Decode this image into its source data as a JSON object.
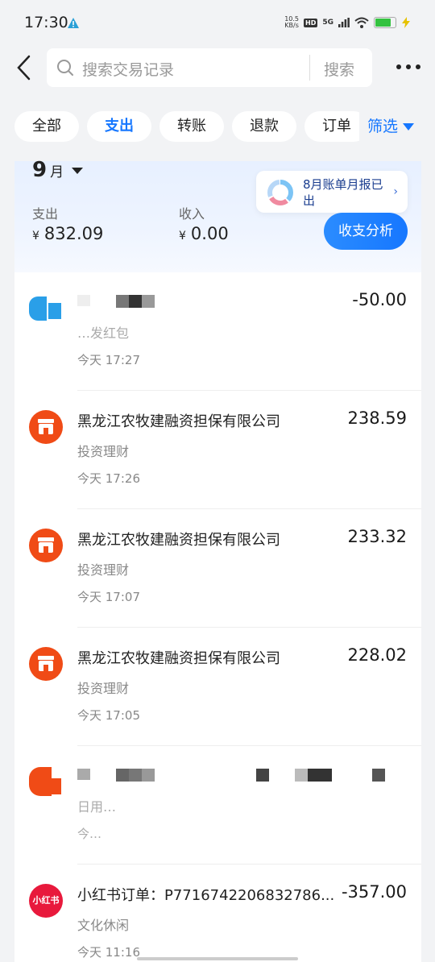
{
  "status_bar": {
    "time": "17:30",
    "net_speed_value": "10.5",
    "net_speed_unit": "KB/s",
    "hd_label": "HD",
    "signal_label": "5G"
  },
  "header": {
    "search_placeholder": "搜索交易记录",
    "search_button": "搜索"
  },
  "tabs": [
    {
      "label": "全部",
      "active": false
    },
    {
      "label": "支出",
      "active": true
    },
    {
      "label": "转账",
      "active": false
    },
    {
      "label": "退款",
      "active": false
    },
    {
      "label": "订单",
      "active": false
    }
  ],
  "filter_label": "筛选",
  "summary": {
    "month_number": "9",
    "month_unit": "月",
    "expense_label": "支出",
    "expense_currency": "¥",
    "expense_value": "832.09",
    "income_label": "收入",
    "income_currency": "¥",
    "income_value": "0.00",
    "report_text": "8月账单月报已出",
    "analyze_button": "收支分析"
  },
  "transactions": [
    {
      "title": "",
      "category": "…发红包",
      "time": "今天 17:27",
      "amount": "-50.00",
      "icon": "blurred-avatar-icon",
      "obscured": true
    },
    {
      "title": "黑龙江农牧建融资担保有限公司",
      "category": "投资理财",
      "time": "今天 17:26",
      "amount": "238.59",
      "icon": "shop-icon"
    },
    {
      "title": "黑龙江农牧建融资担保有限公司",
      "category": "投资理财",
      "time": "今天 17:07",
      "amount": "233.32",
      "icon": "shop-icon"
    },
    {
      "title": "黑龙江农牧建融资担保有限公司",
      "category": "投资理财",
      "time": "今天 17:05",
      "amount": "228.02",
      "icon": "shop-icon"
    },
    {
      "title": "",
      "category": "日用…",
      "time": "今…",
      "amount": "",
      "icon": "blurred-avatar-icon",
      "obscured": true
    },
    {
      "title": "小红书订单：P7716742206832786...",
      "category": "文化休闲",
      "time": "今天 11:16",
      "amount": "-357.00",
      "icon": "xiaohongshu-icon",
      "icon_text": "小红书"
    }
  ],
  "colors": {
    "accent": "#1677ff",
    "shop_icon": "#f04b16",
    "xiaohongshu": "#e8193c",
    "background": "#f2f3f5"
  }
}
